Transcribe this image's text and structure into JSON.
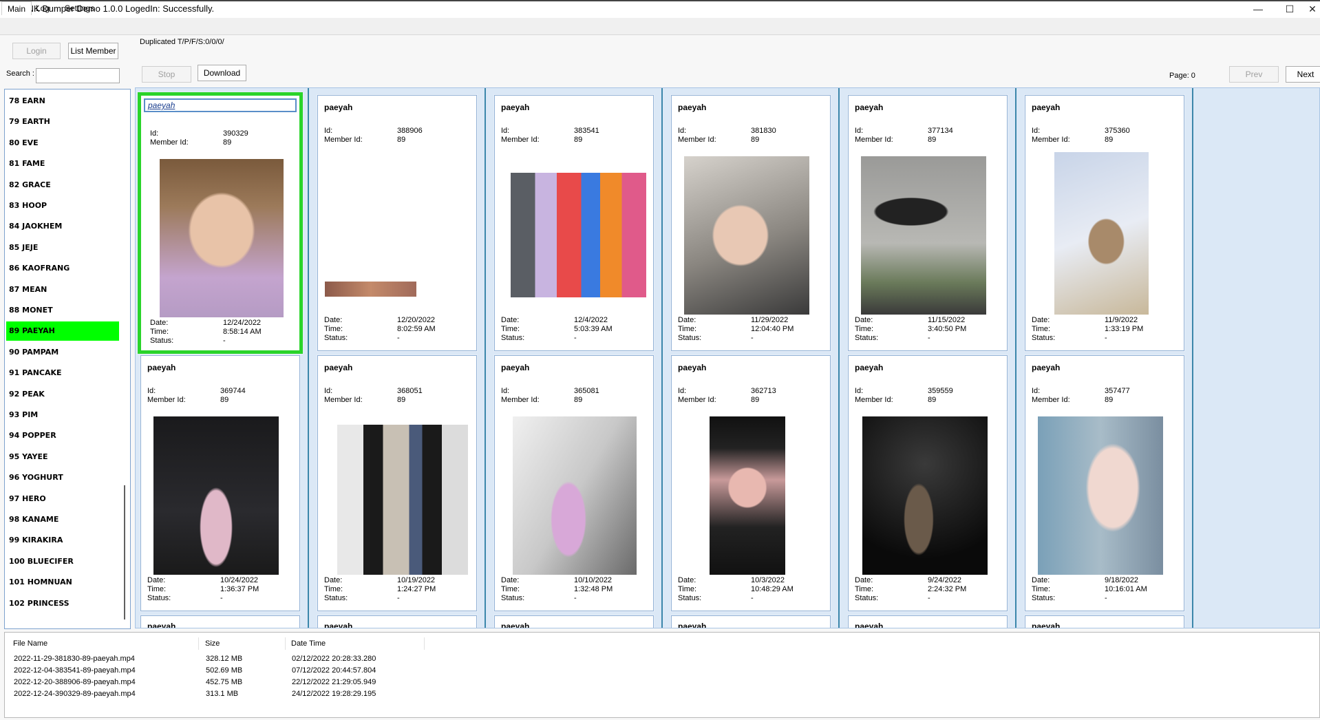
{
  "window": {
    "title": "BNK Dumper Demo 1.0.0 LogedIn: Successfully.",
    "icon_letter": "D",
    "minimize_glyph": "—",
    "maximize_glyph": "☐",
    "close_glyph": "✕"
  },
  "tabs": {
    "main": "Main",
    "log": "Log",
    "settings": "Settings"
  },
  "toolbar": {
    "login": "Login",
    "list_member": "List Member",
    "stop": "Stop",
    "download": "Download",
    "duplicated": "Duplicated T/P/F/S:0/0/0/",
    "page": "Page: 0",
    "prev": "Prev",
    "next": "Next"
  },
  "search": {
    "label": "Search :",
    "value": ""
  },
  "members": [
    "78 EARN",
    "79 EARTH",
    "80 EVE",
    "81 FAME",
    "82 GRACE",
    "83 HOOP",
    "84 JAOKHEM",
    "85 JEJE",
    "86 KAOFRANG",
    "87 MEAN",
    "88 MONET",
    "89 PAEYAH",
    "90 PAMPAM",
    "91 PANCAKE",
    "92 PEAK",
    "93 PIM",
    "94 POPPER",
    "95 YAYEE",
    "96 YOGHURT",
    "97 HERO",
    "98 KANAME",
    "99 KIRAKIRA",
    "100 BLUECIFER",
    "101 HOMNUAN",
    "102 PRINCESS"
  ],
  "selected_member_index": 11,
  "card_labels": {
    "id": "Id:",
    "member_id": "Member Id:",
    "date": "Date:",
    "time": "Time:",
    "status": "Status:"
  },
  "cards": [
    {
      "name": "paeyah",
      "id": "390329",
      "member_id": "89",
      "date": "12/24/2022",
      "time": "8:58:14 AM",
      "status": "-",
      "selected": true
    },
    {
      "name": "paeyah",
      "id": "388906",
      "member_id": "89",
      "date": "12/20/2022",
      "time": "8:02:59 AM",
      "status": "-"
    },
    {
      "name": "paeyah",
      "id": "383541",
      "member_id": "89",
      "date": "12/4/2022",
      "time": "5:03:39 AM",
      "status": "-"
    },
    {
      "name": "paeyah",
      "id": "381830",
      "member_id": "89",
      "date": "11/29/2022",
      "time": "12:04:40 PM",
      "status": "-"
    },
    {
      "name": "paeyah",
      "id": "377134",
      "member_id": "89",
      "date": "11/15/2022",
      "time": "3:40:50 PM",
      "status": "-"
    },
    {
      "name": "paeyah",
      "id": "375360",
      "member_id": "89",
      "date": "11/9/2022",
      "time": "1:33:19 PM",
      "status": "-"
    },
    {
      "name": "paeyah",
      "id": "369744",
      "member_id": "89",
      "date": "10/24/2022",
      "time": "1:36:37 PM",
      "status": "-"
    },
    {
      "name": "paeyah",
      "id": "368051",
      "member_id": "89",
      "date": "10/19/2022",
      "time": "1:24:27 PM",
      "status": "-"
    },
    {
      "name": "paeyah",
      "id": "365081",
      "member_id": "89",
      "date": "10/10/2022",
      "time": "1:32:48 PM",
      "status": "-"
    },
    {
      "name": "paeyah",
      "id": "362713",
      "member_id": "89",
      "date": "10/3/2022",
      "time": "10:48:29 AM",
      "status": "-"
    },
    {
      "name": "paeyah",
      "id": "359559",
      "member_id": "89",
      "date": "9/24/2022",
      "time": "2:24:32 PM",
      "status": "-"
    },
    {
      "name": "paeyah",
      "id": "357477",
      "member_id": "89",
      "date": "9/18/2022",
      "time": "10:16:01 AM",
      "status": "-"
    }
  ],
  "partial_card_name": "paeyah",
  "file_list": {
    "headers": [
      "File Name",
      "Size",
      "Date Time"
    ],
    "rows": [
      [
        "2022-11-29-381830-89-paeyah.mp4",
        "328.12 MB",
        "02/12/2022 20:28:33.280"
      ],
      [
        "2022-12-04-383541-89-paeyah.mp4",
        "502.69 MB",
        "07/12/2022 20:44:57.804"
      ],
      [
        "2022-12-20-388906-89-paeyah.mp4",
        "452.75 MB",
        "22/12/2022 21:29:05.949"
      ],
      [
        "2022-12-24-390329-89-paeyah.mp4",
        "313.1 MB",
        "24/12/2022 19:28:29.195"
      ]
    ]
  }
}
